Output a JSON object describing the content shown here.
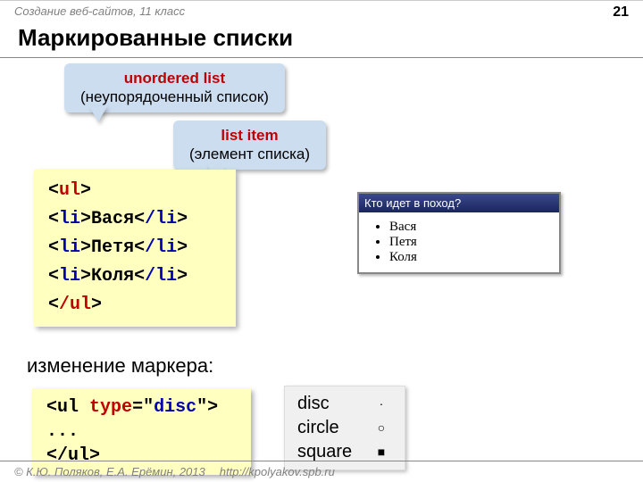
{
  "header": {
    "course": "Создание веб-сайтов, 11 класс",
    "page_number": "21"
  },
  "title": "Маркированные списки",
  "callouts": {
    "unordered_title": "unordered list",
    "unordered_sub": "(неупорядоченный список)",
    "listitem_title": "list item",
    "listitem_sub": "(элемент списка)"
  },
  "code1": {
    "open_lt": "<",
    "ul": "ul",
    "gt": ">",
    "li_open": "li",
    "li_close": "/li",
    "close_ul": "/ul",
    "items": [
      "Вася",
      "Петя",
      "Коля"
    ]
  },
  "browser": {
    "title": "Кто идет в поход?",
    "items": [
      "Вася",
      "Петя",
      "Коля"
    ]
  },
  "subtitle": "изменение маркера:",
  "code2": {
    "open": "<",
    "ul": "ul",
    "space": " ",
    "type_attr": "type",
    "eq": "=\"",
    "disc": "disc",
    "endq": "\">",
    "dots": "...",
    "close_open": "<",
    "close_ul": "/ul",
    "close_gt": ">"
  },
  "markers": {
    "disc_label": "disc",
    "disc_sym": "·",
    "circle_label": "circle",
    "circle_sym": "○",
    "square_label": "square",
    "square_sym": "■"
  },
  "footer": {
    "copyright": "© К.Ю. Поляков, Е.А. Ерёмин, 2013",
    "url": "http://kpolyakov.spb.ru"
  }
}
